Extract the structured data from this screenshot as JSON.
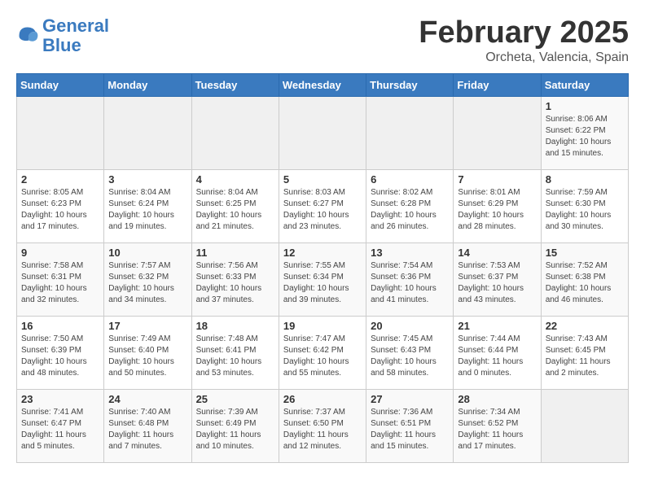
{
  "logo": {
    "text_general": "General",
    "text_blue": "Blue"
  },
  "title": "February 2025",
  "location": "Orcheta, Valencia, Spain",
  "weekdays": [
    "Sunday",
    "Monday",
    "Tuesday",
    "Wednesday",
    "Thursday",
    "Friday",
    "Saturday"
  ],
  "weeks": [
    [
      {
        "day": "",
        "info": ""
      },
      {
        "day": "",
        "info": ""
      },
      {
        "day": "",
        "info": ""
      },
      {
        "day": "",
        "info": ""
      },
      {
        "day": "",
        "info": ""
      },
      {
        "day": "",
        "info": ""
      },
      {
        "day": "1",
        "info": "Sunrise: 8:06 AM\nSunset: 6:22 PM\nDaylight: 10 hours\nand 15 minutes."
      }
    ],
    [
      {
        "day": "2",
        "info": "Sunrise: 8:05 AM\nSunset: 6:23 PM\nDaylight: 10 hours\nand 17 minutes."
      },
      {
        "day": "3",
        "info": "Sunrise: 8:04 AM\nSunset: 6:24 PM\nDaylight: 10 hours\nand 19 minutes."
      },
      {
        "day": "4",
        "info": "Sunrise: 8:04 AM\nSunset: 6:25 PM\nDaylight: 10 hours\nand 21 minutes."
      },
      {
        "day": "5",
        "info": "Sunrise: 8:03 AM\nSunset: 6:27 PM\nDaylight: 10 hours\nand 23 minutes."
      },
      {
        "day": "6",
        "info": "Sunrise: 8:02 AM\nSunset: 6:28 PM\nDaylight: 10 hours\nand 26 minutes."
      },
      {
        "day": "7",
        "info": "Sunrise: 8:01 AM\nSunset: 6:29 PM\nDaylight: 10 hours\nand 28 minutes."
      },
      {
        "day": "8",
        "info": "Sunrise: 7:59 AM\nSunset: 6:30 PM\nDaylight: 10 hours\nand 30 minutes."
      }
    ],
    [
      {
        "day": "9",
        "info": "Sunrise: 7:58 AM\nSunset: 6:31 PM\nDaylight: 10 hours\nand 32 minutes."
      },
      {
        "day": "10",
        "info": "Sunrise: 7:57 AM\nSunset: 6:32 PM\nDaylight: 10 hours\nand 34 minutes."
      },
      {
        "day": "11",
        "info": "Sunrise: 7:56 AM\nSunset: 6:33 PM\nDaylight: 10 hours\nand 37 minutes."
      },
      {
        "day": "12",
        "info": "Sunrise: 7:55 AM\nSunset: 6:34 PM\nDaylight: 10 hours\nand 39 minutes."
      },
      {
        "day": "13",
        "info": "Sunrise: 7:54 AM\nSunset: 6:36 PM\nDaylight: 10 hours\nand 41 minutes."
      },
      {
        "day": "14",
        "info": "Sunrise: 7:53 AM\nSunset: 6:37 PM\nDaylight: 10 hours\nand 43 minutes."
      },
      {
        "day": "15",
        "info": "Sunrise: 7:52 AM\nSunset: 6:38 PM\nDaylight: 10 hours\nand 46 minutes."
      }
    ],
    [
      {
        "day": "16",
        "info": "Sunrise: 7:50 AM\nSunset: 6:39 PM\nDaylight: 10 hours\nand 48 minutes."
      },
      {
        "day": "17",
        "info": "Sunrise: 7:49 AM\nSunset: 6:40 PM\nDaylight: 10 hours\nand 50 minutes."
      },
      {
        "day": "18",
        "info": "Sunrise: 7:48 AM\nSunset: 6:41 PM\nDaylight: 10 hours\nand 53 minutes."
      },
      {
        "day": "19",
        "info": "Sunrise: 7:47 AM\nSunset: 6:42 PM\nDaylight: 10 hours\nand 55 minutes."
      },
      {
        "day": "20",
        "info": "Sunrise: 7:45 AM\nSunset: 6:43 PM\nDaylight: 10 hours\nand 58 minutes."
      },
      {
        "day": "21",
        "info": "Sunrise: 7:44 AM\nSunset: 6:44 PM\nDaylight: 11 hours\nand 0 minutes."
      },
      {
        "day": "22",
        "info": "Sunrise: 7:43 AM\nSunset: 6:45 PM\nDaylight: 11 hours\nand 2 minutes."
      }
    ],
    [
      {
        "day": "23",
        "info": "Sunrise: 7:41 AM\nSunset: 6:47 PM\nDaylight: 11 hours\nand 5 minutes."
      },
      {
        "day": "24",
        "info": "Sunrise: 7:40 AM\nSunset: 6:48 PM\nDaylight: 11 hours\nand 7 minutes."
      },
      {
        "day": "25",
        "info": "Sunrise: 7:39 AM\nSunset: 6:49 PM\nDaylight: 11 hours\nand 10 minutes."
      },
      {
        "day": "26",
        "info": "Sunrise: 7:37 AM\nSunset: 6:50 PM\nDaylight: 11 hours\nand 12 minutes."
      },
      {
        "day": "27",
        "info": "Sunrise: 7:36 AM\nSunset: 6:51 PM\nDaylight: 11 hours\nand 15 minutes."
      },
      {
        "day": "28",
        "info": "Sunrise: 7:34 AM\nSunset: 6:52 PM\nDaylight: 11 hours\nand 17 minutes."
      },
      {
        "day": "",
        "info": ""
      }
    ]
  ]
}
